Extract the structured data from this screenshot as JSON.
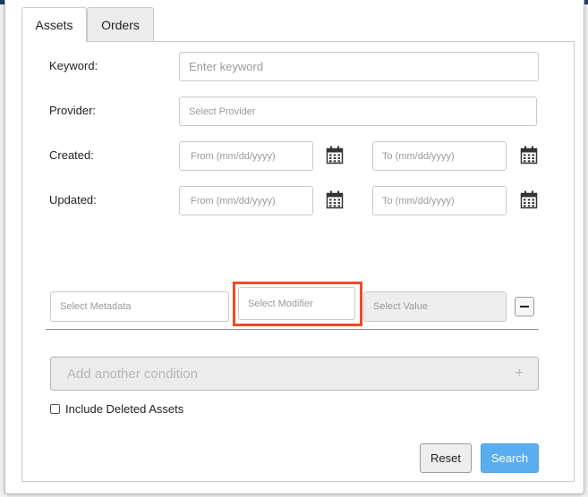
{
  "tabs": [
    {
      "label": "Assets",
      "active": true
    },
    {
      "label": "Orders",
      "active": false
    }
  ],
  "form": {
    "keyword": {
      "label": "Keyword:",
      "placeholder": "Enter keyword"
    },
    "provider": {
      "label": "Provider:",
      "placeholder": "Select Provider"
    },
    "created": {
      "label": "Created:",
      "from_placeholder": "From (mm/dd/yyyy)",
      "to_placeholder": "To (mm/dd/yyyy)"
    },
    "updated": {
      "label": "Updated:",
      "from_placeholder": "From (mm/dd/yyyy)",
      "to_placeholder": "To (mm/dd/yyyy)"
    }
  },
  "condition": {
    "metadata_placeholder": "Select Metadata",
    "modifier_placeholder": "Select Modifier",
    "value_placeholder": "Select Value",
    "highlight_color": "#f04a27"
  },
  "add_condition": {
    "label": "Add another condition",
    "icon": "plus-icon"
  },
  "include_deleted": {
    "label": "Include Deleted Assets",
    "checked": false
  },
  "buttons": {
    "reset": "Reset",
    "search": "Search"
  },
  "colors": {
    "accent": "#5aaef0",
    "topbar": "#1f3c67"
  }
}
